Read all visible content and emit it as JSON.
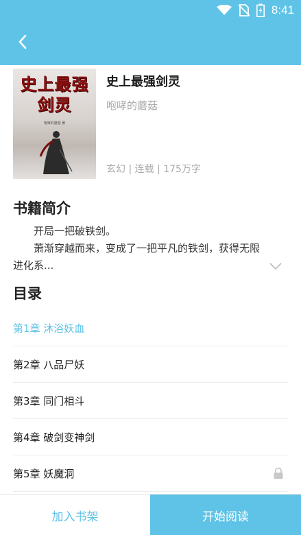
{
  "status_bar": {
    "time": "8:41"
  },
  "book": {
    "title": "史上最强剑灵",
    "author": "咆哮的蘑菇",
    "meta": "玄幻 | 连载 | 175万字",
    "cover": {
      "title_line1": "史上最强",
      "title_line2": "剑灵",
      "author_small": "咆哮的蘑菇 著"
    }
  },
  "intro": {
    "heading": "书籍简介",
    "line1": "开局一把破铁剑。",
    "line2": "萧渐穿越而来，变成了一把平凡的铁剑，获得无限",
    "line3": "进化系..."
  },
  "toc": {
    "heading": "目录",
    "chapters": [
      {
        "label": "第1章 沐浴妖血"
      },
      {
        "label": "第2章 八品尸妖"
      },
      {
        "label": "第3章 同门相斗"
      },
      {
        "label": "第4章 破剑变神剑"
      },
      {
        "label": "第5章 妖魔洞"
      }
    ]
  },
  "actions": {
    "add_shelf": "加入书架",
    "start_read": "开始阅读"
  },
  "colors": {
    "accent": "#5ec3e6"
  }
}
